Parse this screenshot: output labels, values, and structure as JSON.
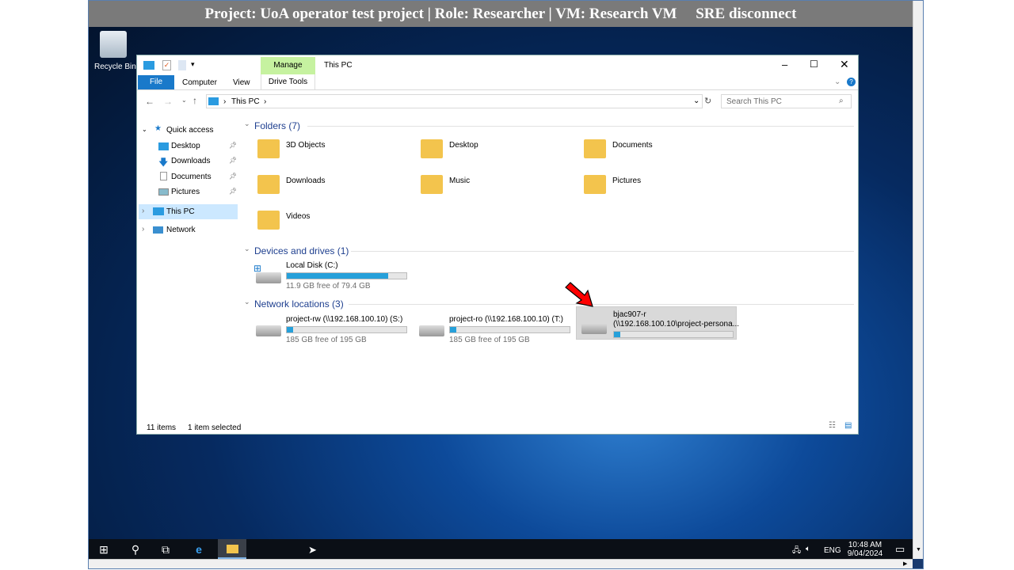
{
  "session_bar": {
    "text": "Project: UoA operator test project | Role: Researcher | VM: Research VM     SRE disconnect"
  },
  "desktop": {
    "recycle_bin": "Recycle Bin"
  },
  "explorer": {
    "title": "This PC",
    "ribbon": {
      "contextual_tab": "Manage",
      "tabs": [
        "File",
        "Computer",
        "View",
        "Drive Tools"
      ]
    },
    "address": {
      "path": "This PC",
      "search_placeholder": "Search This PC"
    },
    "nav": {
      "quick_access": "Quick access",
      "items": [
        "Desktop",
        "Downloads",
        "Documents",
        "Pictures"
      ],
      "this_pc": "This PC",
      "network": "Network"
    },
    "folders": {
      "header": "Folders (7)",
      "items": [
        "3D Objects",
        "Desktop",
        "Documents",
        "Downloads",
        "Music",
        "Pictures",
        "Videos"
      ]
    },
    "devices": {
      "header": "Devices and drives (1)",
      "items": [
        {
          "name": "Local Disk (C:)",
          "free": "11.9 GB free of 79.4 GB",
          "used_fraction": 0.85
        }
      ]
    },
    "network": {
      "header": "Network locations (3)",
      "items": [
        {
          "name": "project-rw (\\\\192.168.100.10) (S:)",
          "free": "185 GB free of 195 GB",
          "used_fraction": 0.05
        },
        {
          "name": "project-ro (\\\\192.168.100.10) (T:)",
          "free": "185 GB free of 195 GB",
          "used_fraction": 0.05
        },
        {
          "name": "bjac907-r",
          "path": "(\\\\192.168.100.10\\project-persona...",
          "used_fraction": 0.05,
          "selected": true
        }
      ]
    },
    "status": {
      "count": "11 items",
      "selected": "1 item selected"
    }
  },
  "taskbar": {
    "lang": "ENG",
    "time": "10:48 AM",
    "date": "9/04/2024"
  },
  "colors": {
    "accent": "#1979ca",
    "manage": "#c6f2a0",
    "annotation_arrow": "#ff0000"
  }
}
